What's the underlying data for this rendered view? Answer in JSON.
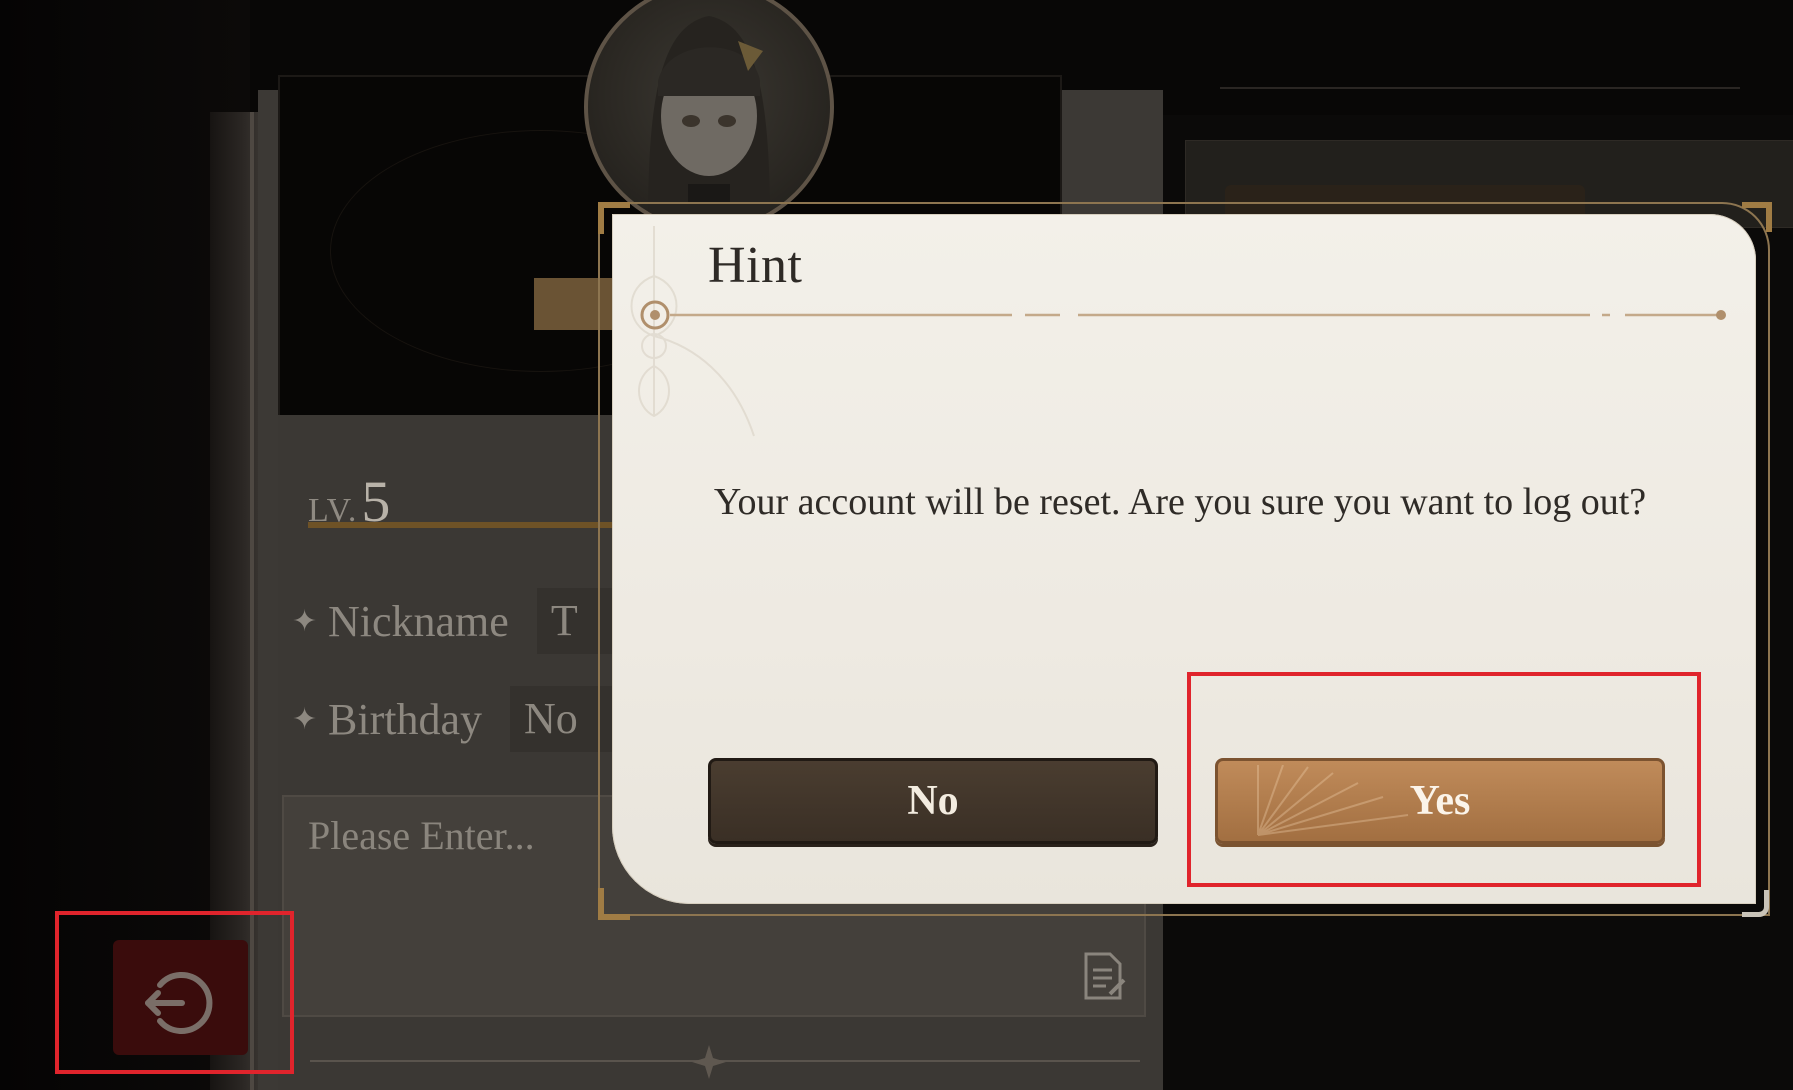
{
  "background": {
    "level": {
      "prefix": "LV.",
      "value": "5"
    },
    "nickname": {
      "label": "Nickname",
      "value": "T"
    },
    "birthday": {
      "label": "Birthday",
      "value": "No"
    },
    "signature_placeholder": "Please Enter..."
  },
  "dialog": {
    "title": "Hint",
    "message": "Your account will be reset. Are you sure you want to log out?",
    "no_label": "No",
    "yes_label": "Yes"
  },
  "icons": {
    "logout": "logout-icon",
    "edit": "edit-note-icon",
    "avatar": "character-avatar"
  },
  "colors": {
    "accent": "#a26f41",
    "highlight": "#e0242c",
    "dialog_bg": "#f0ede6"
  }
}
